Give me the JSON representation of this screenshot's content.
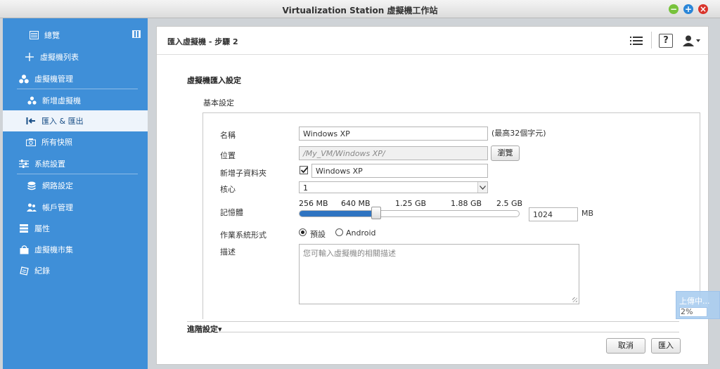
{
  "window": {
    "title": "Virtualization Station 虛擬機工作站",
    "min_label": "−",
    "max_label": "+",
    "close_label": "×"
  },
  "sidebar": {
    "overview": "總覽",
    "vm_list": "虛擬機列表",
    "vm_manage": "虛擬機管理",
    "new_vm": "新增虛擬機",
    "import_export": "匯入 & 匯出",
    "snapshots": "所有快照",
    "system_settings": "系統設置",
    "network": "網路設定",
    "accounts": "帳戶管理",
    "properties": "屬性",
    "marketplace": "虛擬機市集",
    "logs": "紀錄"
  },
  "header": {
    "title": "匯入虛擬機 - 步驟 2",
    "help": "?"
  },
  "form": {
    "section_title": "虛擬機匯入設定",
    "basic_title": "基本設定",
    "name_label": "名稱",
    "name_value": "Windows XP",
    "name_hint": "(最高32個字元)",
    "location_label": "位置",
    "location_value": "/My_VM/Windows XP/",
    "browse_label": "瀏覽",
    "new_folder_label": "新增子資料夾",
    "new_folder_value": "Windows XP",
    "core_label": "核心",
    "core_value": "1",
    "memory_label": "記憶體",
    "memory_ticks": [
      "256 MB",
      "640 MB",
      "1.25 GB",
      "1.88 GB",
      "2.5 GB"
    ],
    "memory_value": "1024",
    "memory_unit": "MB",
    "memory_fraction": 0.35,
    "os_label": "作業系統形式",
    "os_default": "預設",
    "os_android": "Android",
    "desc_label": "描述",
    "desc_placeholder": "您可輸入虛擬機的相關描述",
    "advanced_label": "進階設定▾"
  },
  "footer": {
    "cancel": "取消",
    "import": "匯入"
  },
  "upload": {
    "text": "上傳中...",
    "progress": "2%"
  },
  "colors": {
    "sidebar": "#3f8fd8",
    "accent": "#2f74c1"
  }
}
